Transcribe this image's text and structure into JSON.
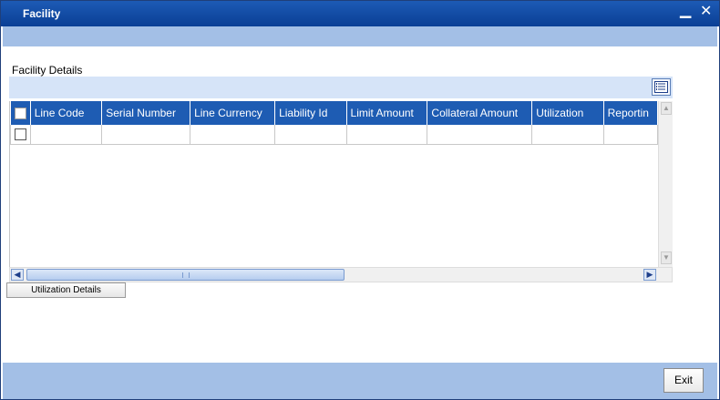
{
  "window": {
    "title": "Facility",
    "minimize_glyph": "▁",
    "close_glyph": "✕"
  },
  "section": {
    "title": "Facility Details"
  },
  "grid": {
    "columns": [
      "Line Code",
      "Serial Number",
      "Line Currency",
      "Liability Id",
      "Limit Amount",
      "Collateral Amount",
      "Utilization",
      "Reportin"
    ],
    "rows": [
      [
        "",
        "",
        "",
        "",
        "",
        "",
        "",
        ""
      ]
    ]
  },
  "buttons": {
    "utilization_details": "Utilization Details",
    "exit": "Exit"
  },
  "scrollbars": {
    "up": "▲",
    "down": "▼",
    "left": "◀",
    "right": "▶"
  },
  "icons": {
    "settings": "column-settings-icon",
    "minimize": "minimize-icon",
    "close": "close-icon"
  },
  "colors": {
    "title_bar": "#0a3f95",
    "header_row": "#1e5cb3",
    "band": "#a3bfe6",
    "toolbar": "#d6e4f8"
  }
}
